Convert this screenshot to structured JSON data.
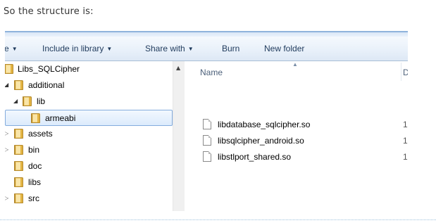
{
  "intro_text": "So the structure is:",
  "toolbar": {
    "cut_item_label": "e",
    "include_label": "Include in library",
    "share_label": "Share with",
    "burn_label": "Burn",
    "new_folder_label": "New folder"
  },
  "nav": {
    "items": [
      {
        "label": "Libs_SQLCipher",
        "expander": ""
      },
      {
        "label": "additional",
        "expander": "◢"
      },
      {
        "label": "lib",
        "expander": "◢"
      },
      {
        "label": "armeabi",
        "expander": "",
        "selected": true
      },
      {
        "label": "assets",
        "expander": "▷"
      },
      {
        "label": "bin",
        "expander": "▷"
      },
      {
        "label": "doc",
        "expander": ""
      },
      {
        "label": "libs",
        "expander": ""
      },
      {
        "label": "src",
        "expander": "▷"
      }
    ]
  },
  "columns": {
    "name": "Name",
    "date": "D"
  },
  "files": [
    {
      "name": "libdatabase_sqlcipher.so",
      "date": "1."
    },
    {
      "name": "libsqlcipher_android.so",
      "date": "1."
    },
    {
      "name": "libstlport_shared.so",
      "date": "1."
    }
  ]
}
